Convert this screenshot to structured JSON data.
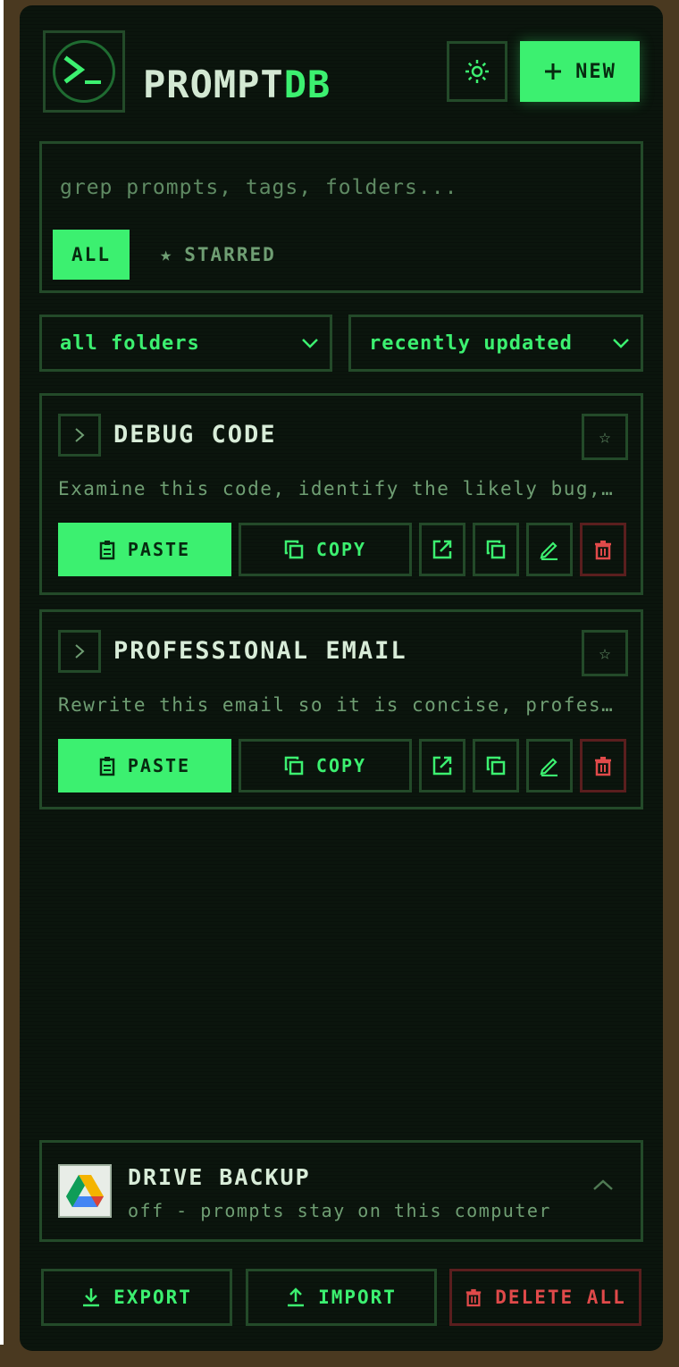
{
  "header": {
    "title_main": "PROMPT",
    "title_accent": "DB",
    "new_label": "NEW"
  },
  "search": {
    "placeholder": "grep prompts, tags, folders...",
    "filter_all": "ALL",
    "filter_starred": "STARRED"
  },
  "selects": {
    "folder": "all folders",
    "sort": "recently updated"
  },
  "prompts": [
    {
      "title": "DEBUG CODE",
      "description": "Examine this code, identify the likely bug, …",
      "paste_label": "PASTE",
      "copy_label": "COPY"
    },
    {
      "title": "PROFESSIONAL EMAIL",
      "description": "Rewrite this email so it is concise, profess…",
      "paste_label": "PASTE",
      "copy_label": "COPY"
    }
  ],
  "backup": {
    "title": "DRIVE BACKUP",
    "status": "off - prompts stay on this computer"
  },
  "footer": {
    "export_label": "EXPORT",
    "import_label": "IMPORT",
    "delete_all_label": "DELETE ALL"
  },
  "colors": {
    "accent": "#3cf070",
    "panel_bg": "#0b150d",
    "border": "#234a29",
    "danger": "#e04a4a",
    "outer_bg": "#4a3920"
  },
  "icons": {
    "logo": "terminal-prompt-icon",
    "theme": "sun-icon",
    "new": "plus-icon",
    "starred": "star-icon",
    "select": "chevron-down-icon",
    "expand": "chevron-right-icon",
    "paste": "clipboard-icon",
    "copy": "copy-icon",
    "open": "external-link-icon",
    "duplicate": "duplicate-icon",
    "edit": "pencil-icon",
    "delete": "trash-icon",
    "drive": "google-drive-icon",
    "collapse": "chevron-up-icon",
    "export": "download-icon",
    "import": "upload-icon"
  }
}
